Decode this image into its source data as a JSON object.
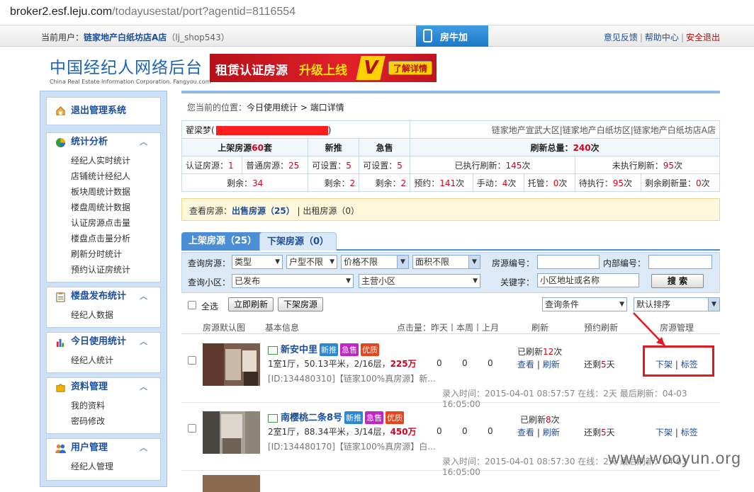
{
  "browser": {
    "url_host": "broker2.esf.leju.com",
    "url_path": "/todayusestat/port?agentid=8116554"
  },
  "topbar": {
    "user_label": "当前用户：",
    "user_name": "链家地产白纸坊店A店",
    "user_account": "（lj_shop543）",
    "app_button": "房牛加",
    "links": [
      "意见反馈",
      "帮助中心",
      "安全退出"
    ]
  },
  "logo": {
    "cn": "中国经纪人网络后台",
    "en": "China Real Estate Information Corporation. Fangyou.com"
  },
  "banner": {
    "text1": "租赁认证房源",
    "text2": "升级上线",
    "v": "V",
    "button": "了解详情"
  },
  "sidebar": {
    "exit": "退出管理系统",
    "sections": [
      {
        "title": "统计分析",
        "items": [
          "经纪人实时统计",
          "店铺统计经纪人",
          "板块周统计数据",
          "楼盘周统计数据",
          "认证房源点击量",
          "楼盘点击量分析",
          "刷新分时统计",
          "预约认证房统计"
        ]
      },
      {
        "title": "楼盘发布统计",
        "items": [
          "经纪人数据"
        ]
      },
      {
        "title": "今日使用统计",
        "items": [
          "经纪人统计"
        ]
      },
      {
        "title": "资料管理",
        "items": [
          "我的资料",
          "密码修改"
        ]
      },
      {
        "title": "用户管理",
        "items": [
          "经纪人管理"
        ]
      }
    ]
  },
  "breadcrumb": {
    "prefix": "您当前的位置：",
    "path": "今日使用统计 > 端口详情"
  },
  "info": {
    "agent_name": "翟梁梦(",
    "agent_suffix": ")",
    "store": "链家地产宣武大区|链家地产白纸坊区|链家地产白纸坊店A店",
    "listed_label": "上架房源",
    "listed_num": "60",
    "listed_unit": "套",
    "tui": "新推",
    "ji": "急售",
    "refresh_total_label": "刷新总量：",
    "refresh_total": "240",
    "refresh_unit": "次",
    "cert_label": "认证房源：",
    "cert": "1",
    "normal_label": "普通房源：",
    "normal": "25",
    "tui_set_label": "可设置：",
    "tui_set": "5",
    "ji_set_label": "可设置：",
    "ji_set": "5",
    "done_label": "已执行刷新：",
    "done": "145",
    "done_unit": "次",
    "undone_label": "未执行刷新：",
    "undone": "95",
    "undone_unit": "次",
    "remain_label": "剩余：",
    "remain": "34",
    "tui_remain": "2",
    "ji_remain": "2",
    "book_label": "预约：",
    "book": "141",
    "book_unit": "次",
    "manual_label": "手动：",
    "manual": "4",
    "manual_unit": "次",
    "host_label": "托管：",
    "host": "0",
    "host_unit": "次",
    "wait_label": "待执行：",
    "wait": "95",
    "wait_unit": "次",
    "left_label": "剩余刷新量：",
    "left": "0",
    "left_unit": "次"
  },
  "viewbar": {
    "label": "查看房源：",
    "sale": "出售房源（25）",
    "sep": "|",
    "rent": "出租房源（0）"
  },
  "tabs": {
    "on": "上架房源（25）",
    "off": "下架房源（0）"
  },
  "search": {
    "house_label": "查询房源：",
    "type": "类型",
    "layout": "户型不限",
    "price": "价格不限",
    "area": "面积不限",
    "code_label": "房源编号：",
    "inner_label": "内部编号：",
    "community_label": "查询小区：",
    "status": "已发布",
    "main_community": "主营小区",
    "keyword_label": "关键字：",
    "keyword_placeholder": "小区地址或名称",
    "search_button": "搜 索"
  },
  "options": {
    "select_all": "全选",
    "refresh_now": "立即刷新",
    "offline": "下架房源",
    "query_cond": "查询条件",
    "sort": "默认排序"
  },
  "columns": {
    "image": "房源默认图",
    "basic": "基本信息",
    "clicks": "点击量：昨天丨本周丨上月",
    "refresh": "刷新",
    "book_refresh": "预约刷新",
    "manage": "房源管理"
  },
  "listings": [
    {
      "title": "新安中里",
      "badges": [
        "新推",
        "急售",
        "优质"
      ],
      "info": "1室1厅，50.13平米，2/16层，",
      "price": "225万",
      "id": "[ID:134480310]【链家100%真房源】新...",
      "clicks": [
        "0",
        "0",
        "0"
      ],
      "refreshed_pre": "已刷新",
      "refreshed": "12",
      "refreshed_unit": "次",
      "view": "查看",
      "refresh": "刷新",
      "remain_pre": "还剩",
      "remain": "5",
      "remain_unit": "天",
      "offline": "下架",
      "tag": "标签",
      "meta": "录入时间：2015-04-01 08:57:57 在线：2天 最后刷新：04-03 16:05:00"
    },
    {
      "title": "南樱桃二条8号",
      "badges": [
        "新推",
        "急售",
        "优质"
      ],
      "info": "2室1厅，88.34平米，3/14层，",
      "price": "450万",
      "id": "[ID:134480170]【链家100%真房源】白...",
      "clicks": [
        "0",
        "0",
        "0"
      ],
      "refreshed_pre": "已刷新",
      "refreshed": "8",
      "refreshed_unit": "次",
      "view": "查看",
      "refresh": "刷新",
      "remain_pre": "还剩",
      "remain": "5",
      "remain_unit": "天",
      "offline": "下架",
      "tag": "标签",
      "meta": "录入时间：2015-04-01 08:57:30 在线：2天 最后刷新：04-03 16:05:00"
    }
  ],
  "watermark": "www.wooyun.org"
}
